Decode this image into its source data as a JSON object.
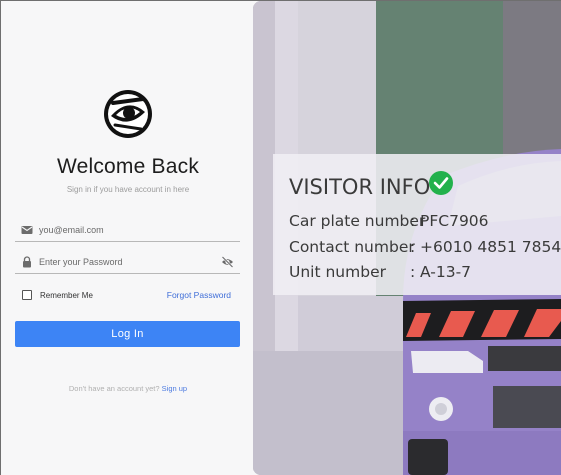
{
  "login": {
    "title": "Welcome Back",
    "subtitle": "Sign in if you have account in here",
    "email_placeholder": "you@email.com",
    "password_placeholder": "Enter your Password",
    "remember_label": "Remember Me",
    "forgot_label": "Forgot Password",
    "login_button": "Log In",
    "signup_prompt": "Don't have an account yet?",
    "signup_link": "Sign up"
  },
  "visitor_card": {
    "title": "VISITOR INFO",
    "rows": [
      {
        "label": "Car plate number",
        "value": "PFC7906"
      },
      {
        "label": "Contact number",
        "value": "+6010 4851 7854"
      },
      {
        "label": "Unit number",
        "value": "A-13-7"
      }
    ]
  },
  "colors": {
    "accent": "#3d84f5",
    "link": "#3f6ed8",
    "check": "#22b14c",
    "car": "#9582c8"
  },
  "icons": [
    "eye-logo-icon",
    "mail-icon",
    "lock-icon",
    "eye-off-icon",
    "checkmark-icon"
  ]
}
